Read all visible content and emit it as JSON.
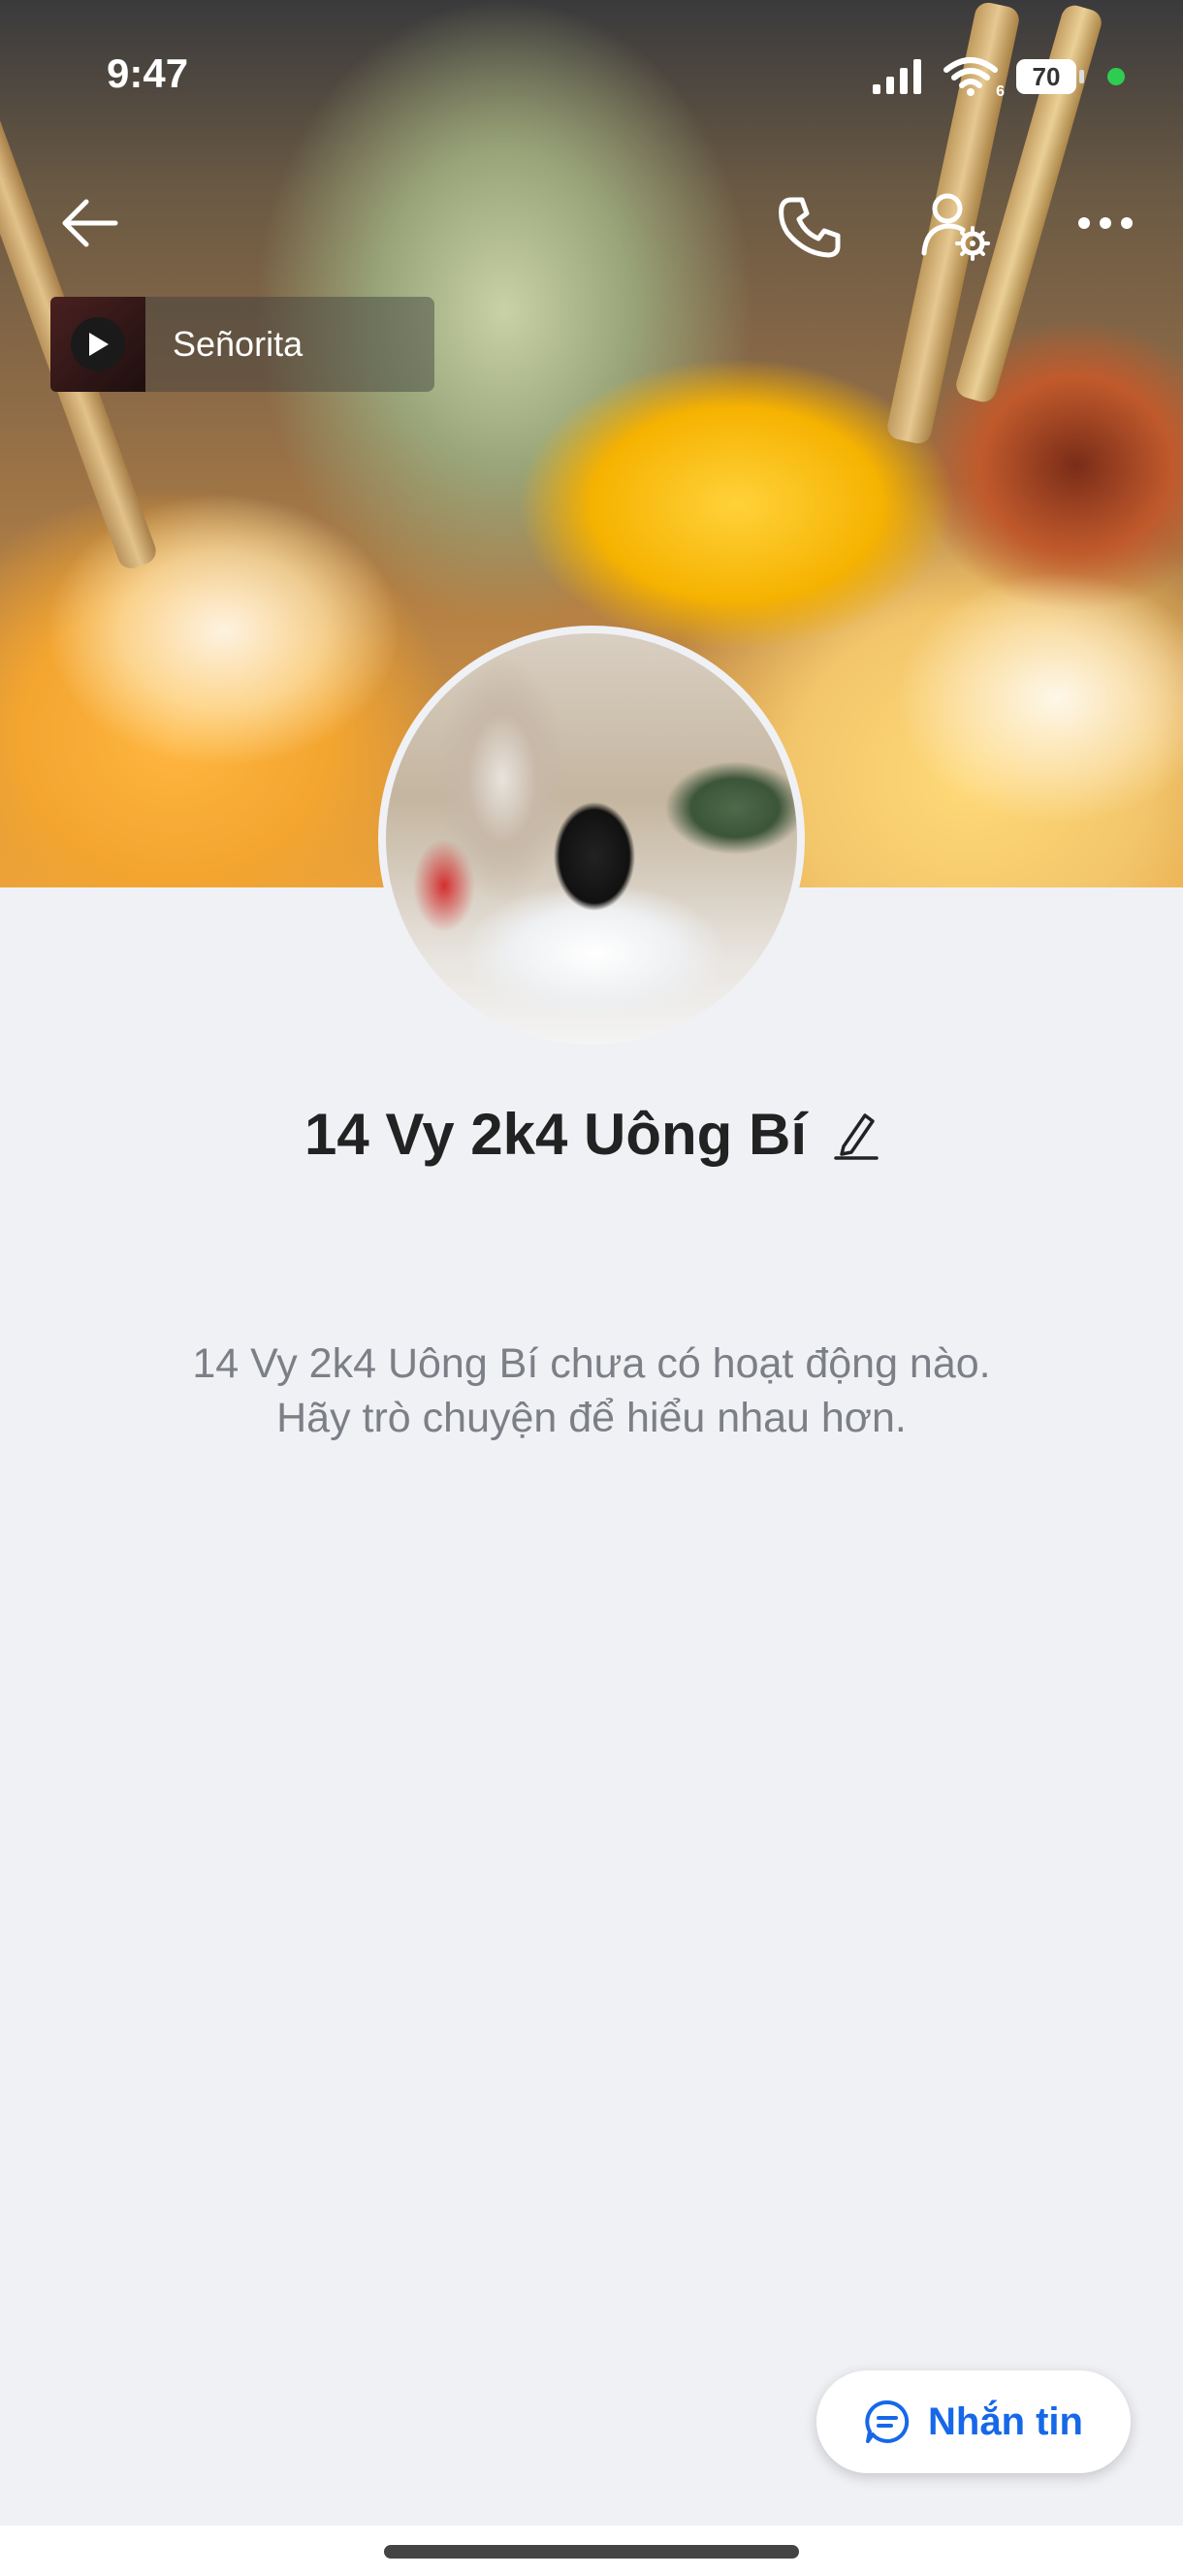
{
  "status_bar": {
    "time": "9:47",
    "battery": "70",
    "wifi_badge": "6"
  },
  "header": {
    "back_icon": "arrow-left-icon",
    "call_icon": "phone-icon",
    "settings_icon": "user-settings-icon",
    "more_icon": "more-dots-icon"
  },
  "music": {
    "title": "Señorita",
    "icon": "play-icon"
  },
  "profile": {
    "name": "14 Vy 2k4 Uông Bí",
    "edit_icon": "pencil-icon"
  },
  "empty_state": {
    "line1": "14 Vy 2k4 Uông Bí chưa có hoạt động nào.",
    "line2": "Hãy trò chuyện để hiểu nhau hơn."
  },
  "message_button": {
    "label": "Nhắn tin",
    "icon": "chat-bubble-icon"
  },
  "colors": {
    "accent": "#1768e8",
    "background": "#f0f1f5",
    "muted_text": "#7c7f86"
  }
}
